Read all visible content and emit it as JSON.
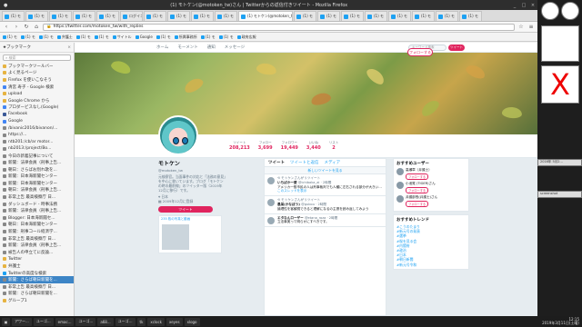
{
  "window": {
    "title": "(1) モトケン(@motoken_tw)さん | Twitterからの返信付きツイート - Mozilla Firefox"
  },
  "tabs": [
    "(1) モ",
    "(1) モ",
    "(1) モ",
    "(1) モ",
    "(1) モ",
    "ログイン",
    "(1) モ",
    "(1) モ",
    "(1) モ",
    "(1) モ",
    "(1) モ",
    "(1) モ",
    "(1) モ",
    "(1) モ",
    "(1) モ",
    "(1) モ",
    "(1) モ",
    "(1) モ"
  ],
  "active_tab": "(1) モトケン(@motoken_tw)さん",
  "url": "https://twitter.com/motoken_tw/with_replies",
  "bookmarks_bar": [
    "(1) モ",
    "(1) モ",
    "(1) モ",
    "弁護士",
    "(1) モ",
    "(1) モ",
    "サイトル",
    "Google",
    "(1) モ",
    "所属事務所",
    "(1) モ",
    "(1) モ",
    "政府広報"
  ],
  "sidebar": {
    "title": "ブックマーク",
    "search_placeholder": "検索",
    "items": [
      {
        "label": "ブックマークツールバー",
        "icon": "folder"
      },
      {
        "label": "よく見るページ",
        "icon": "folder"
      },
      {
        "label": "Firefox を使いこなそう",
        "icon": "folder"
      },
      {
        "label": "清宮 寿子 - Google 検索",
        "icon": "google"
      },
      {
        "label": "upload",
        "icon": "folder"
      },
      {
        "label": "Google Chrome から",
        "icon": "folder"
      },
      {
        "label": "プロダービスなし(Google)",
        "icon": "google"
      },
      {
        "label": "Facebook",
        "icon": "facebook"
      },
      {
        "label": "Google",
        "icon": "google"
      },
      {
        "label": "/bivanic2016/bivanon/...",
        "icon": "page"
      },
      {
        "label": "https://...",
        "icon": "page"
      },
      {
        "label": "ntb201:/cb/ar motor...",
        "icon": "page"
      },
      {
        "label": "nb2013:/project/Bo...",
        "icon": "page"
      },
      {
        "label": "今日の新着記事について",
        "icon": "page"
      },
      {
        "label": "新聞：法律会員（刑事上告...",
        "icon": "page"
      },
      {
        "label": "朝日：さらばお別れ歌を...",
        "icon": "page"
      },
      {
        "label": "新聞：日本海新聞センター",
        "icon": "page"
      },
      {
        "label": "新聞：日本海新聞センター",
        "icon": "page"
      },
      {
        "label": "朝日：法律会員（刑事上告...",
        "icon": "page"
      },
      {
        "label": "非常上告 最高検察庁 日...",
        "icon": "page"
      },
      {
        "label": "ダッシュボード - 時事法務",
        "icon": "page"
      },
      {
        "label": "新聞：法律会員（刑事上告...",
        "icon": "page"
      },
      {
        "label": "Blogger: 日本海新聞セ...",
        "icon": "page"
      },
      {
        "label": "朝日：日本海新聞センター",
        "icon": "page"
      },
      {
        "label": "新聞：刑事コール経済学...",
        "icon": "page"
      },
      {
        "label": "非常上告 最高検察庁 日...",
        "icon": "page"
      },
      {
        "label": "新聞：法律会員（刑事上告...",
        "icon": "page"
      },
      {
        "label": "被告人の申立てに反論...",
        "icon": "page"
      },
      {
        "label": "Twitter",
        "icon": "folder"
      },
      {
        "label": "弁護士",
        "icon": "folder"
      },
      {
        "label": "Twitterの高度な検索",
        "icon": "twitter"
      },
      {
        "label": "新聞：さらば朝日新聞を...",
        "icon": "page"
      },
      {
        "label": "非常上告 最高検察庁 日...",
        "icon": "page"
      },
      {
        "label": "新聞：さらば朝日新聞を...",
        "icon": "page"
      },
      {
        "label": "グループ1",
        "icon": "folder"
      }
    ],
    "selected_index": 31
  },
  "twitter_nav": {
    "home": "ホーム",
    "moments": "モーメント",
    "notifications": "通知",
    "messages": "メッセージ",
    "search_placeholder": "キーワード検索",
    "tweet_button": "ツイート"
  },
  "profile": {
    "name": "モトケン",
    "handle": "@motoken_tw",
    "bio": "元検察官。当面事件の対応と「法務の意見」を中心に書いています。ブログ「モトケンの時の最前線」のツイッター版（2019年12月に移行）です。",
    "location": "日本",
    "joined": "2009年12月に登録",
    "tweet_button": "ツイート",
    "media_label": "235 枚の写真と動画"
  },
  "stats": [
    {
      "label": "ツイート",
      "value": "208,213"
    },
    {
      "label": "フォロー",
      "value": "3,699"
    },
    {
      "label": "フォロワー",
      "value": "19,449"
    },
    {
      "label": "いいね",
      "value": "3,440"
    },
    {
      "label": "リスト",
      "value": "2"
    }
  ],
  "follow_button": "フォローする",
  "timeline": {
    "tabs": [
      "ツイート",
      "ツイートと返信",
      "メディア"
    ],
    "active_tab": 0,
    "new_tweets": "新しいツイートを見る",
    "tweets": [
      {
        "retweet": "モトケンさんがリツイート",
        "name": "いちばかー愛",
        "meta": "@ichibaka_ai · 2時間",
        "text": "アメリカ一般市民の人は刑事裁判でも人種に左右される部分が大きい…",
        "more": "このスレッドを表示"
      },
      {
        "retweet": "モトケンさんがリツイート",
        "name": "愚呆(かなぼう)",
        "meta": "@gubou · 2時間",
        "text": "論理性を客観視できると理解になるの主張を読み返してみよう",
        "more": ""
      },
      {
        "retweet": "",
        "name": "エタなんローザー",
        "meta": "@etana_roza · 2時間",
        "text": "立法事実って明らかにすべきです。",
        "more": ""
      }
    ]
  },
  "right": {
    "who_to_follow_title": "おすすめユーザー",
    "users": [
      {
        "name": "高瀬章（弁護士）",
        "handle": "@takase",
        "button": "フォローする"
      },
      {
        "name": "小池晃 (TIGER)さん",
        "handle": "@koike",
        "button": "フォローする"
      },
      {
        "name": "弁護部長(弁護士)さん",
        "handle": "@bengo",
        "button": "フォローする"
      }
    ],
    "trends_title": "おすすめトレンド",
    "trends": [
      "#こうのたまり",
      "#新元号の発表",
      "#選挙",
      "#桜を見る会",
      "#内閣府",
      "#政治",
      "#日本",
      "#朝日新聞",
      "#新元号令和"
    ]
  },
  "right_panel": {
    "labels": [
      "screenshot",
      "2016年 5月2..."
    ]
  },
  "taskbar": {
    "items": [
      "アワー...",
      "ユーゴ...",
      "emac...",
      "ユーゴ...",
      "a68...",
      "ユーゴ...",
      "tk",
      "xclock",
      "xeyes",
      "xlogo"
    ],
    "clock": "12:15",
    "date": "2019年3月11日(土曜)"
  },
  "colors": {
    "brand": "#1da1f2",
    "accent": "#e0245e"
  }
}
